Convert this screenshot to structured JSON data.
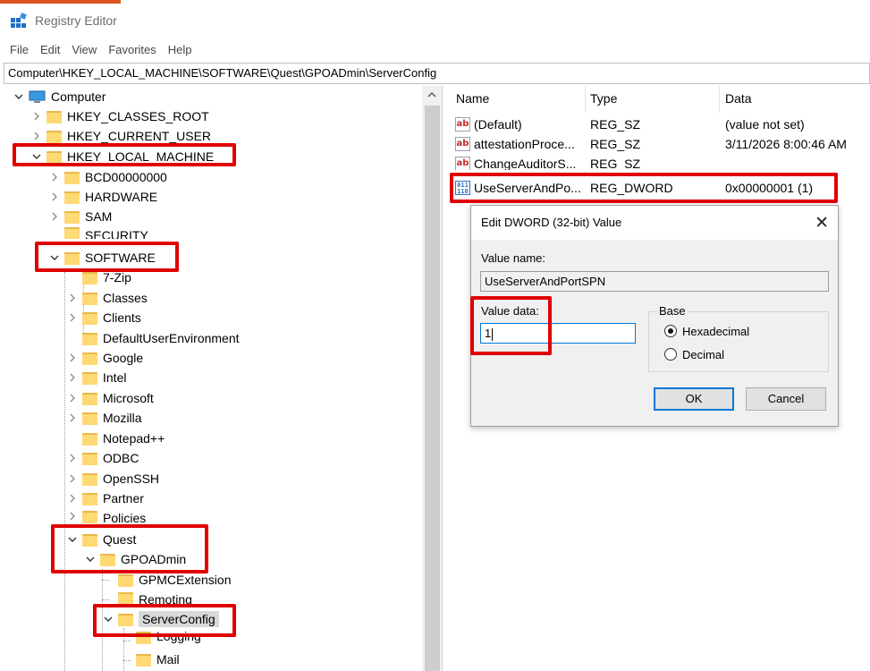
{
  "colors": {
    "accent": "#d9541e",
    "highlight": "#e00000"
  },
  "window": {
    "title": "Registry Editor",
    "icon": "registry-editor-icon"
  },
  "menu": [
    "File",
    "Edit",
    "View",
    "Favorites",
    "Help"
  ],
  "address": "Computer\\HKEY_LOCAL_MACHINE\\SOFTWARE\\Quest\\GPOADmin\\ServerConfig",
  "tree": {
    "root": "Computer",
    "hkcr": "HKEY_CLASSES_ROOT",
    "hkcu": "HKEY_CURRENT_USER",
    "hklm": "HKEY_LOCAL_MACHINE",
    "bcd": "BCD00000000",
    "hardware": "HARDWARE",
    "sam": "SAM",
    "security": "SECURITY",
    "software": "SOFTWARE",
    "zip": "7-Zip",
    "classes": "Classes",
    "clients": "Clients",
    "defaultuser": "DefaultUserEnvironment",
    "google": "Google",
    "intel": "Intel",
    "microsoft": "Microsoft",
    "mozilla": "Mozilla",
    "notepad": "Notepad++",
    "odbc": "ODBC",
    "openssh": "OpenSSH",
    "partner": "Partner",
    "policies": "Policies",
    "quest": "Quest",
    "gpoadmin": "GPOADmin",
    "gpmcext": "GPMCExtension",
    "remoting": "Remoting",
    "serverconfig": "ServerConfig",
    "logging": "Logging",
    "mail": "Mail"
  },
  "list": {
    "headers": {
      "name": "Name",
      "type": "Type",
      "data": "Data"
    },
    "rows": [
      {
        "name": "(Default)",
        "type": "REG_SZ",
        "data": "(value not set)",
        "icon": "string-value-icon"
      },
      {
        "name": "attestationProce...",
        "type": "REG_SZ",
        "data": "3/11/2026 8:00:46 AM",
        "icon": "string-value-icon"
      },
      {
        "name": "ChangeAuditorS...",
        "type": "REG_SZ",
        "data": "",
        "icon": "string-value-icon"
      },
      {
        "name": "UseServerAndPo...",
        "type": "REG_DWORD",
        "data": "0x00000001 (1)",
        "icon": "binary-value-icon"
      }
    ]
  },
  "dialog": {
    "title": "Edit DWORD (32-bit) Value",
    "value_name_label": "Value name:",
    "value_name": "UseServerAndPortSPN",
    "value_data_label": "Value data:",
    "value_data": "1",
    "base_label": "Base",
    "hex_label": "Hexadecimal",
    "dec_label": "Decimal",
    "selected_base": "Hexadecimal",
    "ok": "OK",
    "cancel": "Cancel"
  }
}
